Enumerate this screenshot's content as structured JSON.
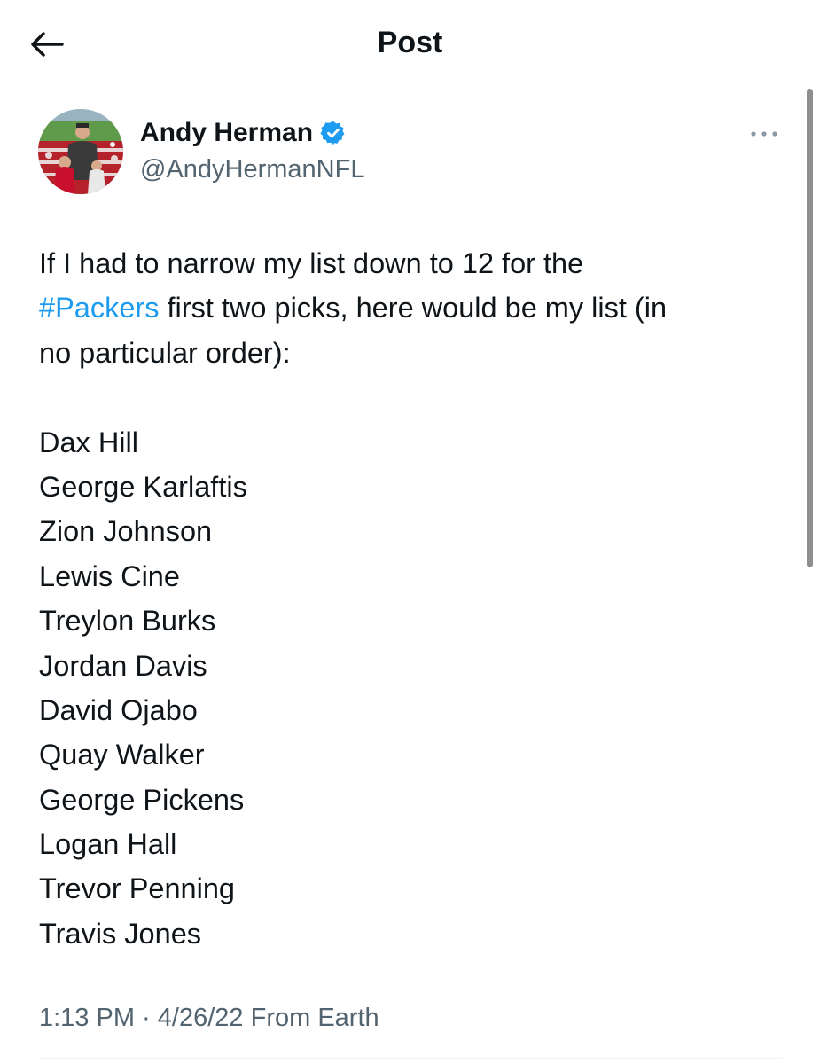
{
  "header": {
    "title": "Post"
  },
  "author": {
    "name": "Andy Herman",
    "handle": "@AndyHermanNFL",
    "verified": true,
    "verified_color": "#1d9bf0"
  },
  "tweet": {
    "line1": "If I had to narrow my list down to 12 for the",
    "hashtag": "#Packers",
    "line2_rest": " first two picks, here would be my list (in",
    "line3": "no particular order):",
    "players": [
      "Dax Hill",
      "George Karlaftis",
      "Zion Johnson",
      "Lewis Cine",
      "Treylon Burks",
      "Jordan Davis",
      "David Ojabo",
      "Quay Walker",
      "George Pickens",
      "Logan Hall",
      "Trevor Penning",
      "Travis Jones"
    ]
  },
  "meta": {
    "time": "1:13 PM",
    "separator": " · ",
    "date": "4/26/22",
    "source": " From Earth"
  },
  "colors": {
    "text": "#0f1419",
    "secondary": "#536471",
    "link": "#1d9bf0"
  },
  "icons": {
    "back": "arrow-left-icon",
    "verified": "verified-badge-icon",
    "more": "more-dots-icon"
  }
}
